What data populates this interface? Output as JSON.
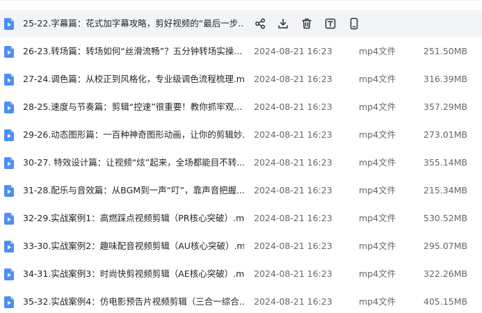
{
  "files": [
    {
      "name": "25-22.字幕篇：花式加字幕攻略，剪好视频的“最后一步...",
      "date": "",
      "type": "",
      "size": "",
      "hovered": true
    },
    {
      "name": "26-23.转场篇：转场如何“丝滑流畅”？五分钟转场实操...",
      "date": "2024-08-21 16:23",
      "type": "mp4文件",
      "size": "251.50MB"
    },
    {
      "name": "27-24.调色篇：从校正到风格化，专业级调色流程梳理.m...",
      "date": "2024-08-21 16:23",
      "type": "mp4文件",
      "size": "316.39MB"
    },
    {
      "name": "28-25.速度与节奏篇：剪辑“控速”很重要！教你抓牢观...",
      "date": "2024-08-21 16:23",
      "type": "mp4文件",
      "size": "357.29MB"
    },
    {
      "name": "29-26.动态图形篇：一百种神奇图形动画，让你的剪辑妙...",
      "date": "2024-08-21 16:23",
      "type": "mp4文件",
      "size": "273.01MB"
    },
    {
      "name": "30-27. 特效设计篇：让视频“炫”起来，全场都能目不转...",
      "date": "2024-08-21 16:23",
      "type": "mp4文件",
      "size": "355.14MB"
    },
    {
      "name": "31-28.配乐与音效篇：从BGM到一声“叮”，靠声音把握...",
      "date": "2024-08-21 16:23",
      "type": "mp4文件",
      "size": "215.34MB"
    },
    {
      "name": "32-29.实战案例1：高燃踩点视频剪辑（PR核心突破）.m...",
      "date": "2024-08-21 16:23",
      "type": "mp4文件",
      "size": "530.52MB"
    },
    {
      "name": "33-30.实战案例2：趣味配音视频剪辑（AU核心突破）.m...",
      "date": "2024-08-21 16:23",
      "type": "mp4文件",
      "size": "295.07MB"
    },
    {
      "name": "34-31.实战案例3：时尚快剪视频剪辑（AE核心突破）.m...",
      "date": "2024-08-21 16:23",
      "type": "mp4文件",
      "size": "322.26MB"
    },
    {
      "name": "35-32.实战案例4：仿电影预告片视频剪辑（三合一综合...",
      "date": "2024-08-21 16:23",
      "type": "mp4文件",
      "size": "405.15MB"
    }
  ],
  "hover_actions": [
    "share-icon",
    "download-icon",
    "delete-icon",
    "text-icon",
    "phone-icon"
  ],
  "colors": {
    "file_icon": "#4a90f5",
    "hover_row": "#f3f4f7",
    "name_text": "#1f2329",
    "meta_text": "#606770"
  }
}
